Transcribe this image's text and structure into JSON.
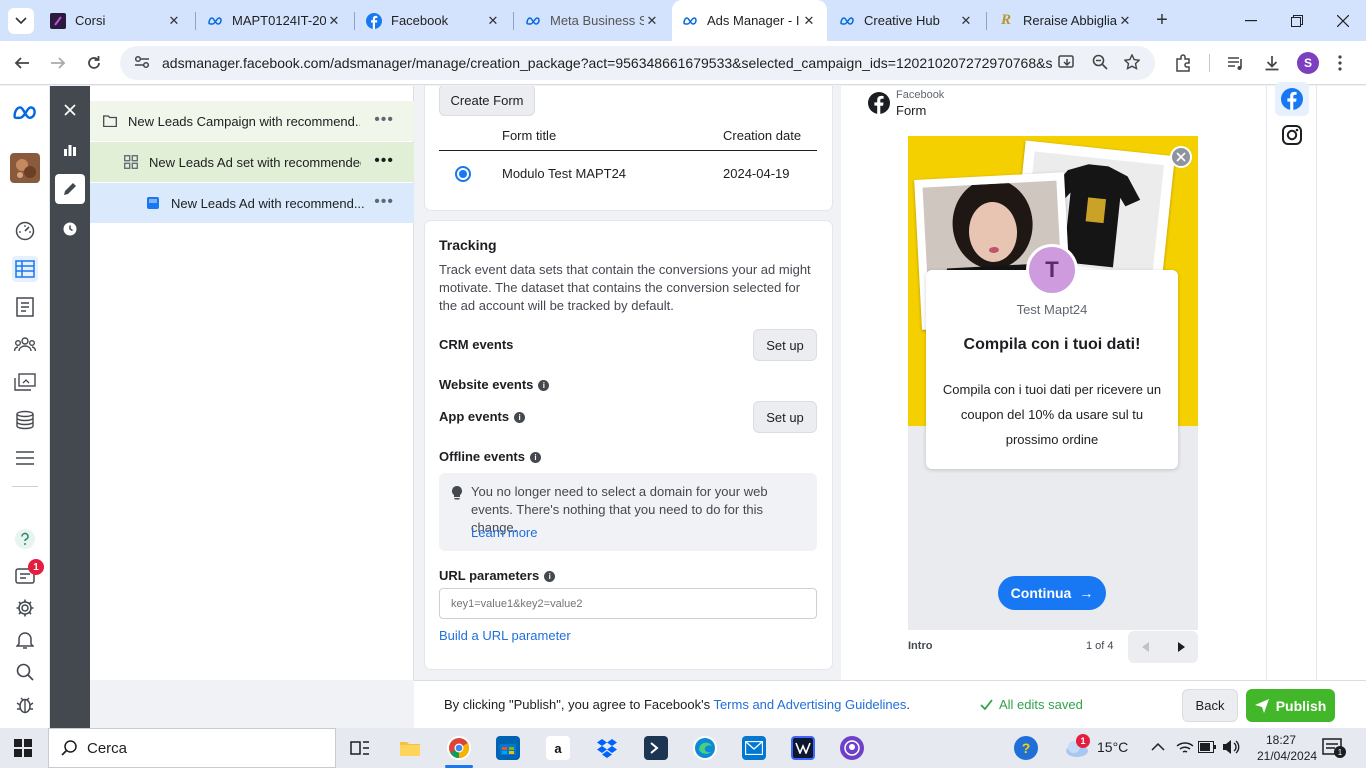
{
  "browser": {
    "tabs": [
      {
        "title": "Corsi",
        "icon": "corsi-icon"
      },
      {
        "title": "MAPT0124IT-20",
        "icon": "meta-infinity-icon"
      },
      {
        "title": "Facebook",
        "icon": "facebook-icon"
      },
      {
        "title": "Meta Business S",
        "icon": "meta-infinity-icon"
      },
      {
        "title": "Ads Manager - I",
        "icon": "meta-infinity-icon"
      },
      {
        "title": "Creative Hub",
        "icon": "meta-infinity-icon"
      },
      {
        "title": "Reraise Abbiglia",
        "icon": "reraise-icon"
      }
    ],
    "url": "adsmanager.facebook.com/adsmanager/manage/creation_package?act=956348661679533&selected_campaign_ids=120210207272970768&se..."
  },
  "tree": {
    "items": [
      {
        "label": "New Leads Campaign with recommend...",
        "more": "•••"
      },
      {
        "label": "New Leads Ad set with recommended...",
        "more": "•••"
      },
      {
        "label": "New Leads Ad with recommend...",
        "more": "•••"
      }
    ]
  },
  "form_card": {
    "create_form_label": "Create Form",
    "col_title": "Form title",
    "col_date": "Creation date",
    "rows": [
      {
        "title": "Modulo Test MAPT24",
        "date": "2024-04-19"
      }
    ]
  },
  "tracking": {
    "heading": "Tracking",
    "description": "Track event data sets that contain the conversions your ad might motivate. The dataset that contains the conversion selected for the ad account will be tracked by default.",
    "crm_label": "CRM events",
    "setup_label": "Set up",
    "website_label": "Website events",
    "app_label": "App events",
    "offline_label": "Offline events",
    "notice": "You no longer need to select a domain for your web events. There's nothing that you need to do for this change.",
    "learn_more": "Learn more",
    "url_params_label": "URL parameters",
    "url_params_placeholder": "key1=value1&key2=value2",
    "build_url_link": "Build a URL parameter"
  },
  "preview": {
    "source_platform": "Facebook",
    "source_type": "Form",
    "avatar_letter": "T",
    "page_name": "Test Mapt24",
    "headline": "Compila con i tuoi dati!",
    "body": "Compila con i tuoi dati per ricevere un coupon del 10% da usare sul tu prossimo ordine",
    "cta": "Continua",
    "cta_arrow": "→",
    "stage": "Intro",
    "pager": "1 of 4",
    "banner_color": "#f5d000"
  },
  "footer": {
    "agree_prefix": "By clicking \"Publish\", you agree to Facebook's ",
    "agree_link": "Terms and Advertising Guidelines",
    "agree_suffix": ".",
    "saved_status": "All edits saved",
    "back_label": "Back",
    "publish_label": "Publish"
  },
  "taskbar": {
    "search_placeholder": "Cerca",
    "weather": "15°C",
    "time": "18:27",
    "date": "21/04/2024",
    "notification_count": "1"
  },
  "rail": {
    "notification_badge": "1"
  },
  "colors": {
    "accent": "#1877f2",
    "publish": "#42b72a",
    "saved": "#31a24c"
  }
}
